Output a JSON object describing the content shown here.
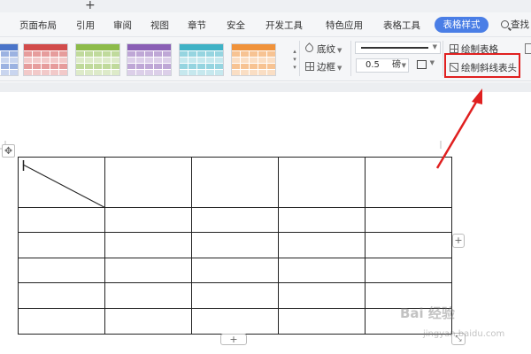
{
  "tabstrip": {
    "new_tab_glyph": "+"
  },
  "menu": {
    "items": [
      "页面布局",
      "引用",
      "审阅",
      "视图",
      "章节",
      "安全",
      "开发工具",
      "特色应用",
      "表格工具"
    ],
    "active_tab": "表格样式",
    "search_label": "查找"
  },
  "toolbar": {
    "shading_label": "底纹",
    "border_label": "边框",
    "draw_table_label": "绘制表格",
    "draw_diagonal_label": "绘制斜线表头",
    "line_width_value": "0.5",
    "line_width_unit": "磅",
    "style_colors": [
      "#4a74c9",
      "#d24b4b",
      "#8dbb4a",
      "#8a5fb5",
      "#3fb2c6",
      "#f0923a"
    ]
  },
  "document": {
    "move_handle_glyph": "✥",
    "add_column_glyph": "+",
    "add_row_glyph": "+",
    "resize_glyph": "⤡",
    "watermark": "Bai 经验",
    "watermark_sub": "jingyan.baidu.com"
  },
  "colors": {
    "accent": "#4a7ee6",
    "highlight": "#e02020"
  }
}
